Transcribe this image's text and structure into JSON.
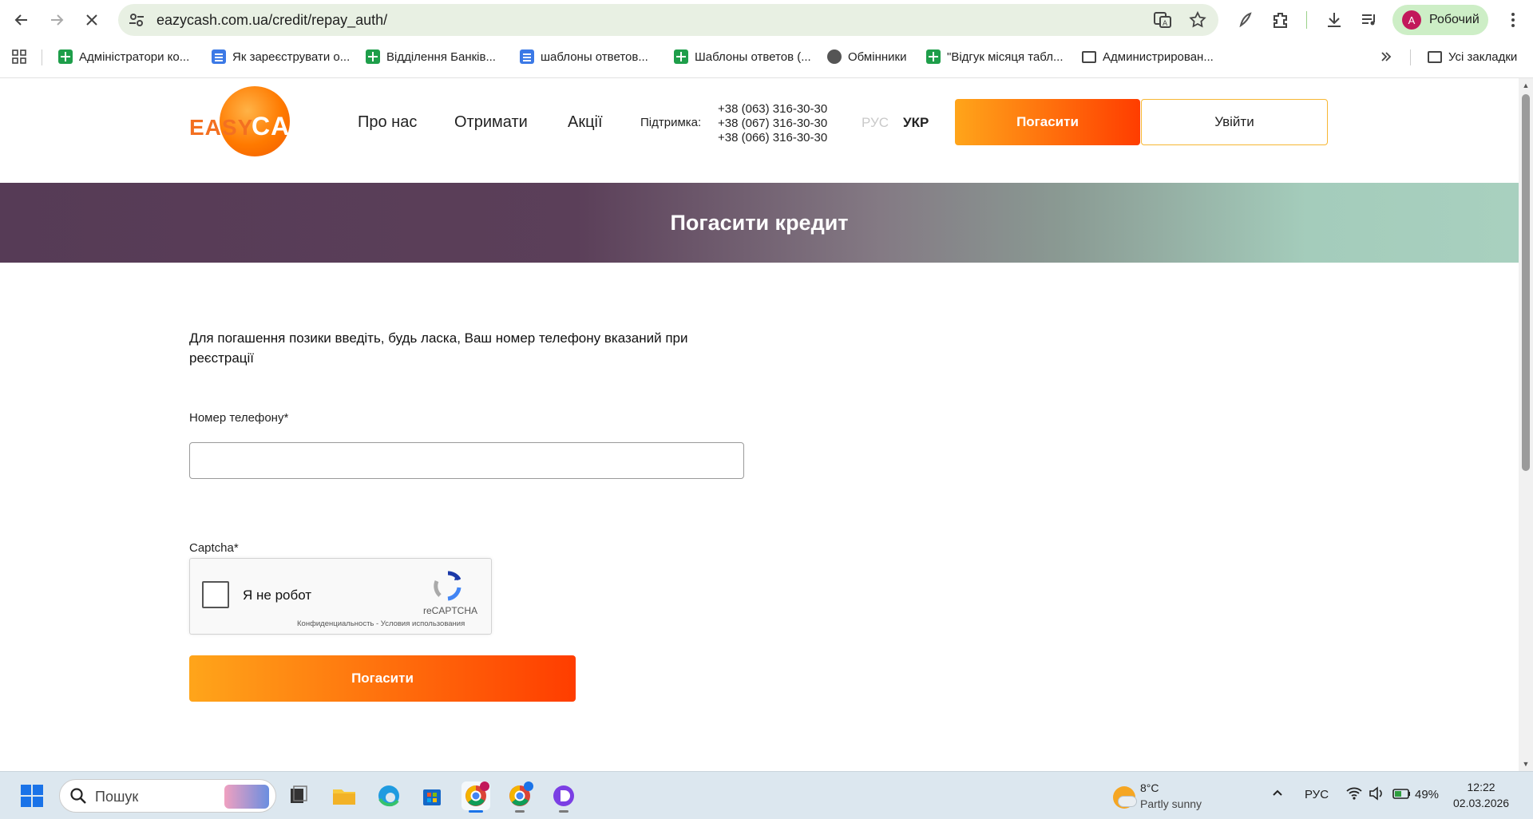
{
  "browser": {
    "url": "eazycash.com.ua/credit/repay_auth/",
    "profile_name": "Робочий",
    "profile_initial": "A",
    "bookmarks": [
      {
        "label": "Адміністратори ко...",
        "icon": "sheets-icon"
      },
      {
        "label": "Як зареєструвати о...",
        "icon": "docs-icon"
      },
      {
        "label": "Відділення Банків...",
        "icon": "sheets-icon"
      },
      {
        "label": "шаблоны ответов...",
        "icon": "docs-icon"
      },
      {
        "label": "Шаблоны ответов (...",
        "icon": "sheets-icon"
      },
      {
        "label": "Обмінники",
        "icon": "globe-icon"
      },
      {
        "label": "\"Відгук місяця табл...",
        "icon": "sheets-icon"
      },
      {
        "label": "Администрирован...",
        "icon": "folder-icon"
      }
    ],
    "all_bookmarks": "Усі закладки"
  },
  "site": {
    "logo_easy": "EASY",
    "logo_cash": "CASH",
    "nav": [
      "Про нас",
      "Отримати",
      "Акції"
    ],
    "support_label": "Підтримка:",
    "phones": [
      "+38 (063) 316-30-30",
      "+38 (067) 316-30-30",
      "+38 (066) 316-30-30"
    ],
    "lang_ru": "РУС",
    "lang_uk": "УКР",
    "btn_pay": "Погасити",
    "btn_login": "Увійти"
  },
  "banner": {
    "title": "Погасити кредит"
  },
  "form": {
    "intro": "Для погашення позики введіть, будь ласка, Ваш номер телефону вказаний при реєстрації",
    "phone_label": "Номер телефону*",
    "phone_value": "",
    "captcha_label": "Captcha*",
    "recaptcha_text": "Я не робот",
    "recaptcha_brand": "reCAPTCHA",
    "recaptcha_links": "Конфиденциальность - Условия использования",
    "submit": "Погасити"
  },
  "taskbar": {
    "search_placeholder": "Пошук",
    "weather_temp": "8°C",
    "weather_desc": "Partly sunny",
    "lang": "РУС",
    "battery": "49%",
    "time": "12:22",
    "date": "02.03.2026"
  },
  "colors": {
    "accent_orange": "#ff7a00",
    "banner_start": "#563b56",
    "banner_end": "#a8d0bf"
  }
}
